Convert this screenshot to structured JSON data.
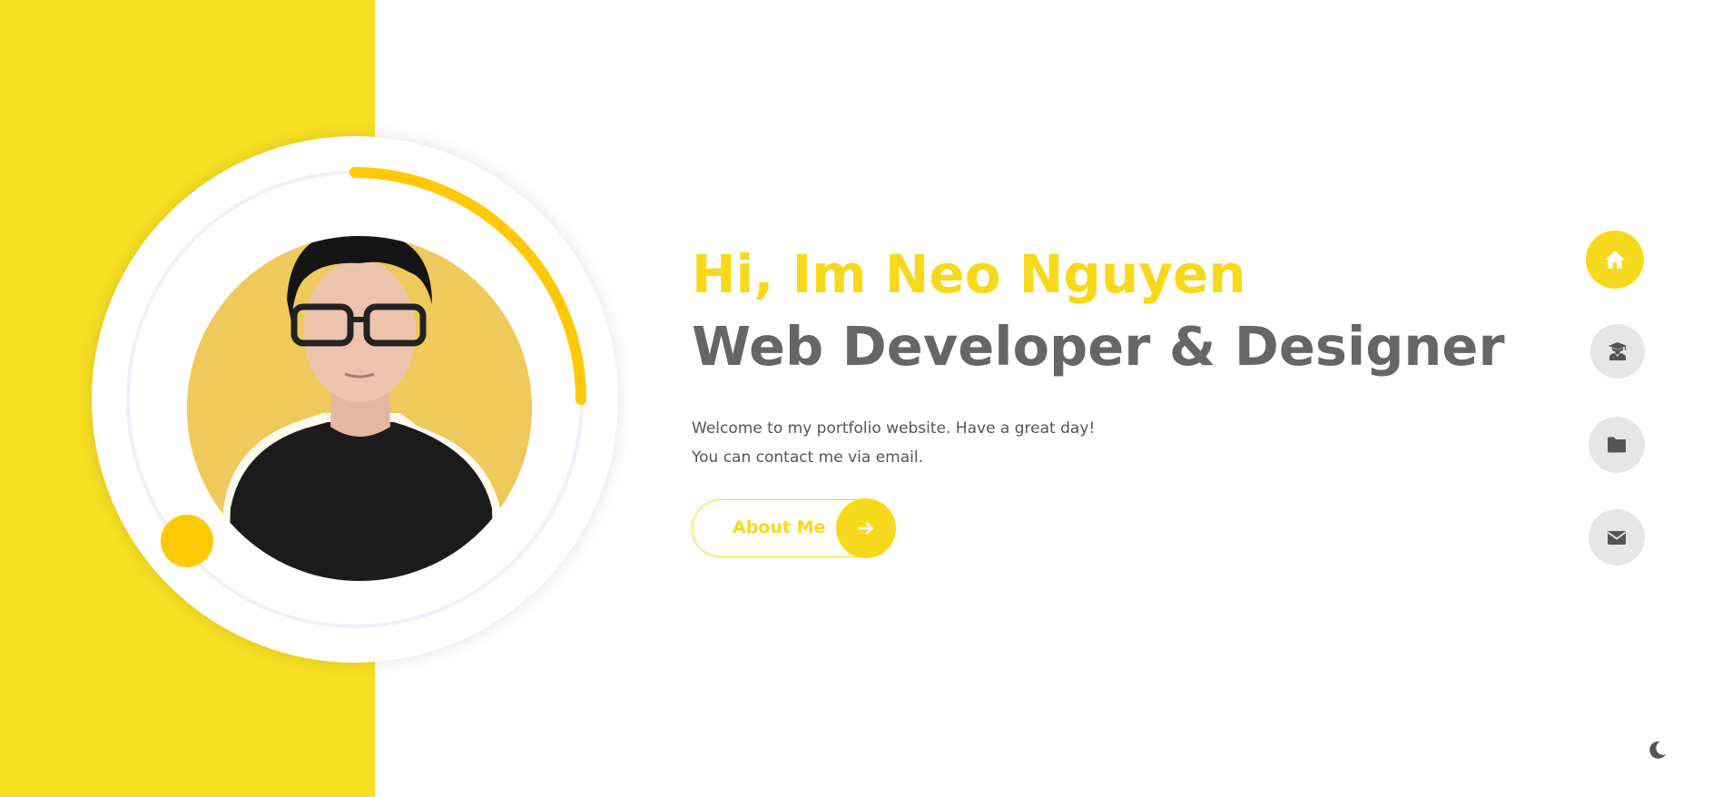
{
  "hero": {
    "greeting": "Hi, Im Neo Nguyen",
    "role": "Web Developer & Designer",
    "description_line1": "Welcome to my portfolio website. Have a great day!",
    "description_line2": "You can contact me via email.",
    "about_button_label": "About Me"
  },
  "nav": {
    "items": [
      {
        "name": "home",
        "icon": "home-icon",
        "active": true
      },
      {
        "name": "education",
        "icon": "graduate-icon",
        "active": false
      },
      {
        "name": "portfolio",
        "icon": "folder-icon",
        "active": false
      },
      {
        "name": "contact",
        "icon": "envelope-icon",
        "active": false
      }
    ]
  },
  "theme_toggle": {
    "icon": "moon-icon"
  },
  "colors": {
    "accent": "#f7df22",
    "accent_text": "#f7d91c",
    "ring_progress": "#ffc908",
    "heading_gray": "#666666",
    "body_gray": "#555555",
    "nav_inactive": "#e6e6e6",
    "icon_dark": "#555555"
  }
}
